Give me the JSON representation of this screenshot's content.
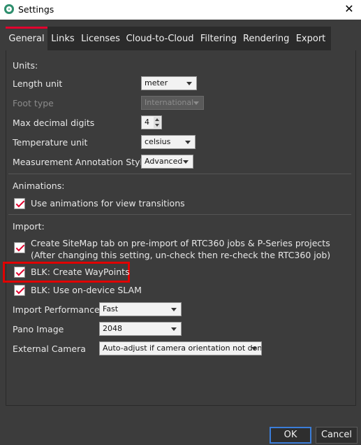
{
  "window": {
    "title": "Settings",
    "close_icon": "close-icon"
  },
  "tabs": [
    {
      "label": "General",
      "active": true
    },
    {
      "label": "Links"
    },
    {
      "label": "Licenses"
    },
    {
      "label": "Cloud-to-Cloud"
    },
    {
      "label": "Filtering"
    },
    {
      "label": "Rendering"
    },
    {
      "label": "Export"
    }
  ],
  "units": {
    "section": "Units:",
    "length_label": "Length unit",
    "length_value": "meter",
    "foot_label": "Foot type",
    "foot_value": "International",
    "decimal_label": "Max decimal digits",
    "decimal_value": "4",
    "temp_label": "Temperature unit",
    "temp_value": "celsius",
    "annotation_label": "Measurement Annotation Style",
    "annotation_value": "Advanced"
  },
  "animations": {
    "section": "Animations:",
    "use_animations": "Use animations for view transitions"
  },
  "import": {
    "section": "Import:",
    "sitemap_line1": "Create SiteMap tab on pre-import of RTC360 jobs & P-Series projects",
    "sitemap_line2": "(After changing this setting, un-check then re-check the RTC360 job)",
    "blk_waypoints": "BLK: Create WayPoints",
    "blk_slam": "BLK: Use on-device SLAM",
    "perf_label": "Import Performance",
    "perf_value": "Fast",
    "pano_label": "Pano Image",
    "pano_value": "2048",
    "camera_label": "External Camera",
    "camera_value": "Auto-adjust if camera orientation not done"
  },
  "buttons": {
    "ok": "OK",
    "cancel": "Cancel"
  },
  "colors": {
    "accent": "#e1002d",
    "highlight": "#e00000",
    "ok_border": "#3b7dd8"
  }
}
